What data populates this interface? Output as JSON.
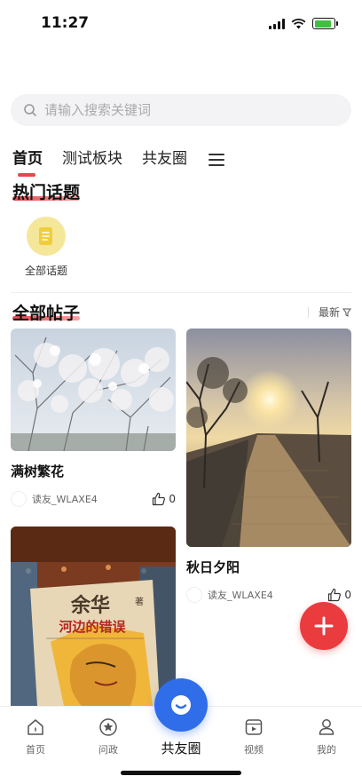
{
  "status": {
    "time": "11:27"
  },
  "search": {
    "placeholder": "请输入搜索关键词"
  },
  "tabs": [
    {
      "label": "首页",
      "active": true
    },
    {
      "label": "测试板块",
      "active": false
    },
    {
      "label": "共友圈",
      "active": false
    }
  ],
  "hot_topics": {
    "title": "热门话题",
    "items": [
      {
        "label": "全部话题"
      }
    ]
  },
  "posts_section": {
    "title": "全部帖子",
    "sort_label": "最新"
  },
  "posts": [
    {
      "title": "满树繁花",
      "author": "读友_WLAXE4",
      "likes": "0"
    },
    {
      "title": "秋日夕阳",
      "author": "读友_WLAXE4",
      "likes": "0"
    },
    {
      "book_title": "余华",
      "book_author_mark": "著",
      "book_subtitle": "河边的错误"
    }
  ],
  "bottom_nav": {
    "home": "首页",
    "ask": "问政",
    "center": "共友圈",
    "video": "视频",
    "mine": "我的"
  },
  "colors": {
    "accent": "#e8464a",
    "fab": "#ea3b3f",
    "center_button": "#2f6ee8"
  }
}
